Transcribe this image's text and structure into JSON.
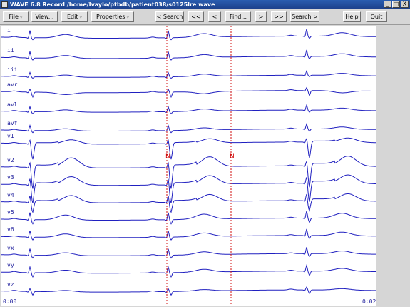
{
  "window": {
    "title": "WAVE 6.8  Record /home/Ivaylo/ptbdb/patient038/s0125lre wave",
    "minimize": "_",
    "maximize": "□",
    "close": "X"
  },
  "toolbar": {
    "file": "File",
    "view": "View...",
    "edit": "Edit",
    "properties": "Properties",
    "search_back": "< Search",
    "page_back": "<<",
    "step_back": "<",
    "find": "Find...",
    "step_fwd": ">",
    "page_fwd": ">>",
    "search_fwd": "Search >",
    "help": "Help",
    "quit": "Quit",
    "menu_arrow": "▿"
  },
  "signals": [
    "i",
    "ii",
    "iii",
    "avr",
    "avl",
    "avf",
    "v1",
    "v2",
    "v3",
    "v4",
    "v5",
    "v6",
    "vx",
    "vy",
    "vz"
  ],
  "annotations": [
    "N",
    "N"
  ],
  "time": {
    "start": "0:00",
    "end": "0:02"
  },
  "colors": {
    "trace": "#2020c0",
    "marker": "#d01010",
    "label": "#1a1a9a"
  }
}
